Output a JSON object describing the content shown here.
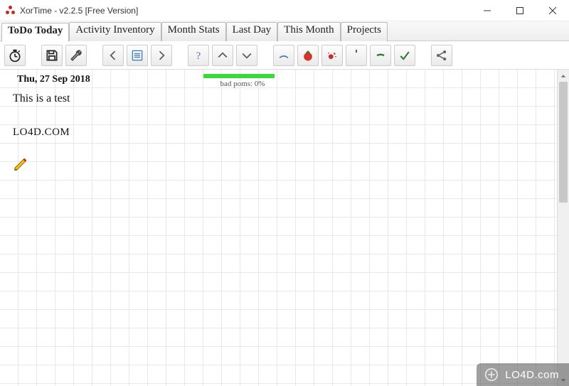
{
  "window": {
    "title": "XorTime - v2.2.5 [Free Version]"
  },
  "tabs": [
    {
      "label": "ToDo Today",
      "active": true
    },
    {
      "label": "Activity Inventory",
      "active": false
    },
    {
      "label": "Month Stats",
      "active": false
    },
    {
      "label": "Last Day",
      "active": false
    },
    {
      "label": "This Month",
      "active": false
    },
    {
      "label": "Projects",
      "active": false
    }
  ],
  "toolbar": {
    "timer": "timer",
    "save": "save",
    "settings": "settings",
    "prev": "prev",
    "today_list": "today-list",
    "next": "next",
    "help": "help",
    "up": "up",
    "down": "down",
    "mark_blue": "blue-arc",
    "tomato": "tomato",
    "interrupt": "interrupt",
    "apostrophe": "apostrophe",
    "dash": "dash",
    "check": "check",
    "share": "share"
  },
  "content": {
    "date": "Thu, 27 Sep 2018",
    "progress_label": "bad poms: 0%",
    "line1": "This is a test",
    "line2": "LO4D.COM"
  },
  "watermark": "LO4D.com"
}
